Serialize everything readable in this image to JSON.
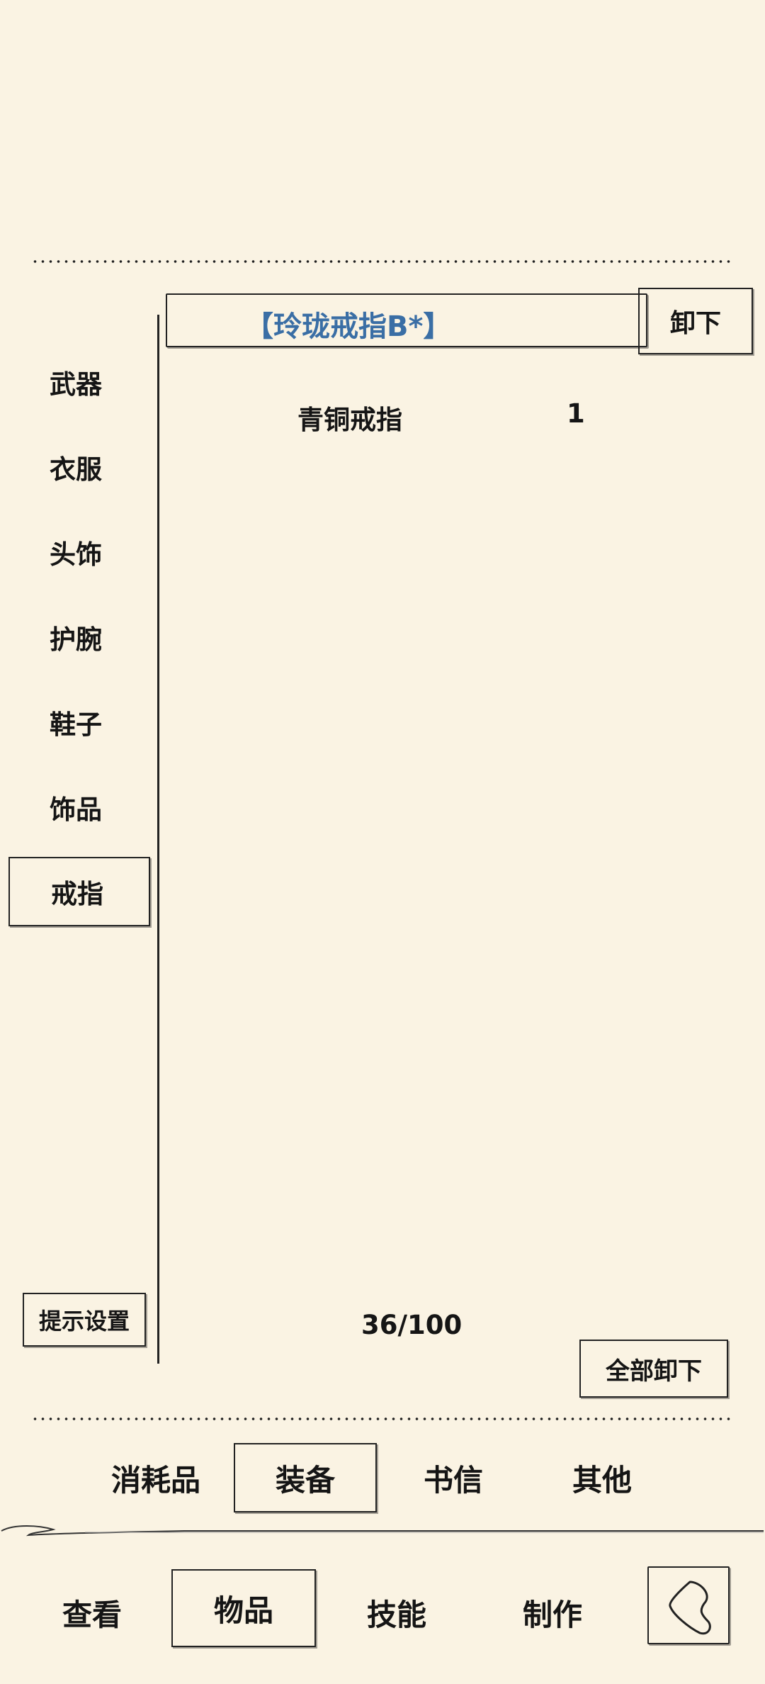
{
  "equipped": {
    "title": "【玲珑戒指B*】",
    "title_color": "#3a6ea5",
    "unequip_label": "卸下"
  },
  "categories": [
    {
      "label": "武器"
    },
    {
      "label": "衣服"
    },
    {
      "label": "头饰"
    },
    {
      "label": "护腕"
    },
    {
      "label": "鞋子"
    },
    {
      "label": "饰品"
    },
    {
      "label": "戒指"
    }
  ],
  "active_category": "戒指",
  "items": [
    {
      "name": "青铜戒指",
      "count": "1"
    }
  ],
  "hint_settings_label": "提示设置",
  "capacity": "36/100",
  "unequip_all_label": "全部卸下",
  "inventory_tabs": [
    {
      "label": "消耗品"
    },
    {
      "label": "装备"
    },
    {
      "label": "书信"
    },
    {
      "label": "其他"
    }
  ],
  "active_inventory_tab": "装备",
  "main_nav": [
    {
      "label": "查看"
    },
    {
      "label": "物品"
    },
    {
      "label": "技能"
    },
    {
      "label": "制作"
    }
  ],
  "active_main_nav": "物品",
  "back_icon": "back-chevron-icon"
}
